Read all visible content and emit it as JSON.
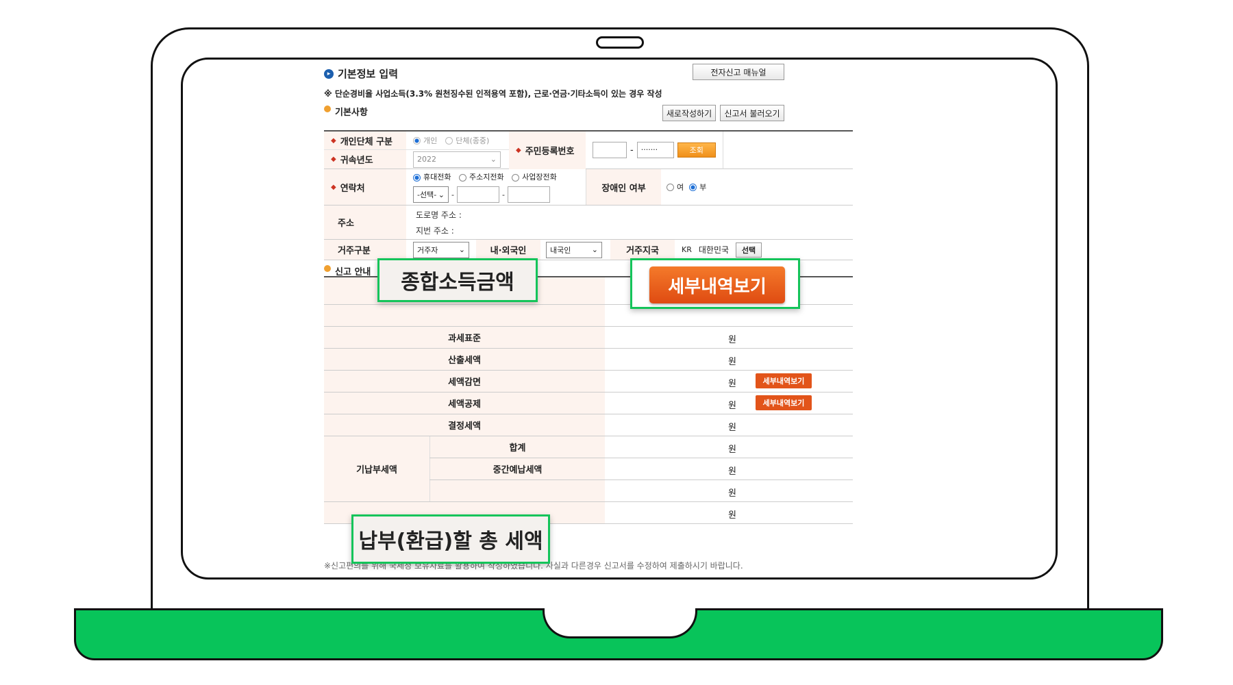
{
  "page": {
    "title": "기본정보 입력",
    "manual_button": "전자신고 매뉴얼",
    "notice": "※ 단순경비율 사업소득(3.3% 원천징수된 인적용역 포함), 근로·연금·기타소득이 있는 경우 작성"
  },
  "basic": {
    "title": "기본사항",
    "new_button": "새로작성하기",
    "load_button": "신고서 불러오기",
    "person_type_label": "개인단체 구분",
    "person_option": "개인",
    "group_option": "단체(종중)",
    "year_label": "귀속년도",
    "year_value": "2022",
    "ssn_label": "주민등록번호",
    "ssn_masked": "·······",
    "ssn_dash": "-",
    "lookup_button": "조회",
    "contact_label": "연락처",
    "phone_mobile": "휴대전화",
    "phone_home": "주소지전화",
    "phone_work": "사업장전화",
    "phone_select": "-선택-",
    "dash": "-",
    "disabled_label": "장애인 여부",
    "yes": "여",
    "no": "부",
    "address_label": "주소",
    "road_address": "도로명 주소 :",
    "lot_address": "지번 주소 :",
    "residence_label": "거주구분",
    "residence_value": "거주자",
    "nationality_label": "내·외국인",
    "nationality_value": "내국인",
    "country_label": "거주지국",
    "country_code": "KR",
    "country_name": "대한민국",
    "country_select": "선택"
  },
  "report": {
    "title": "신고 안내",
    "rows": [
      {
        "label": "과세표준",
        "unit": "원"
      },
      {
        "label": "산출세액",
        "unit": "원"
      },
      {
        "label": "세액감면",
        "unit": "원",
        "button": "세부내역보기"
      },
      {
        "label": "세액공제",
        "unit": "원",
        "button": "세부내역보기"
      },
      {
        "label": "결정세액",
        "unit": "원"
      }
    ],
    "prepaid_label": "기납부세액",
    "prepaid_rows": [
      {
        "label": "합계",
        "unit": "원"
      },
      {
        "label": "중간예납세액",
        "unit": "원"
      },
      {
        "label": "",
        "unit": "원"
      }
    ],
    "final_unit": "원",
    "footnote": "※신고편의를 위해 국세청 보유자료를 활용하여 작성하였습니다. 사실과 다른경우 신고서를 수정하여 제출하시기 바랍니다."
  },
  "callouts": {
    "total_income": "종합소득금액",
    "detail_button": "세부내역보기",
    "total_tax": "납부(환급)할 총 세액"
  },
  "colors": {
    "accent_green": "#08c45a",
    "detail_orange": "#e2541a",
    "label_bg": "#fdf3ee"
  }
}
